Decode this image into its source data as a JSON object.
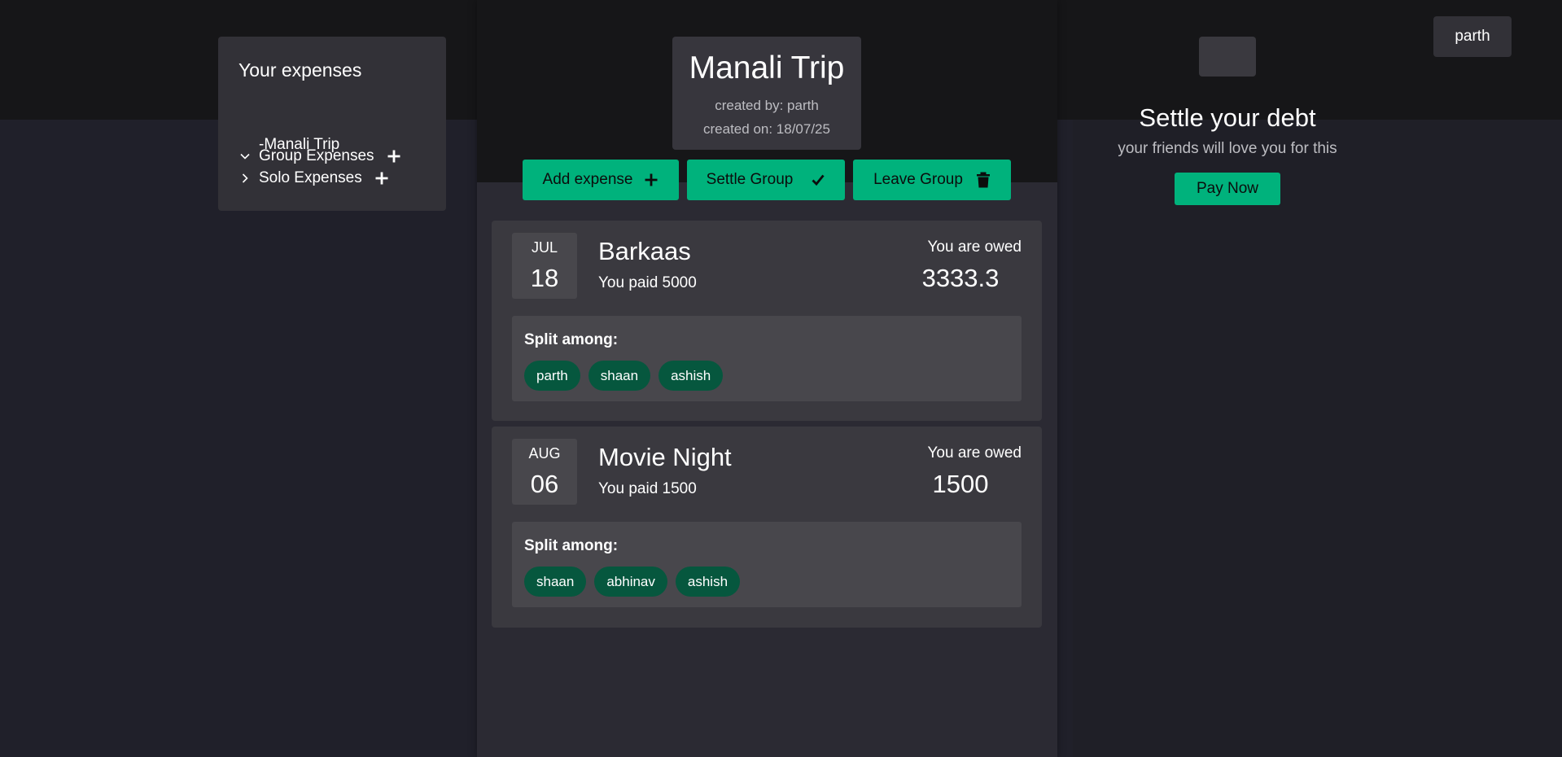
{
  "sidebar": {
    "title": "Your expenses",
    "group_expenses_label": "Group Expenses",
    "groups": [
      "-Manali Trip"
    ],
    "solo_expenses_label": "Solo Expenses"
  },
  "group": {
    "name": "Manali Trip",
    "created_by": "created by: parth",
    "created_on": "created on: 18/07/25"
  },
  "actions": {
    "add_expense": "Add expense",
    "settle_group": "Settle Group",
    "leave_group": "Leave Group"
  },
  "expenses": [
    {
      "month": "JUL",
      "day": "18",
      "title": "Barkaas",
      "paid": "You paid 5000",
      "owed_label": "You are owed",
      "owed_amount": "3333.3",
      "split_label": "Split among:",
      "members": [
        "parth",
        "shaan",
        "ashish"
      ]
    },
    {
      "month": "AUG",
      "day": "06",
      "title": "Movie Night",
      "paid": "You paid 1500",
      "owed_label": "You are owed",
      "owed_amount": "1500",
      "split_label": "Split among:",
      "members": [
        "shaan",
        "abhinav",
        "ashish"
      ]
    }
  ],
  "settle": {
    "title": "Settle your debt",
    "subtitle": "your friends will love you for this",
    "pay_label": "Pay Now"
  },
  "user": {
    "name": "parth"
  },
  "colors": {
    "accent": "#00b27c",
    "chip": "#06573e",
    "background": "#20202a"
  }
}
